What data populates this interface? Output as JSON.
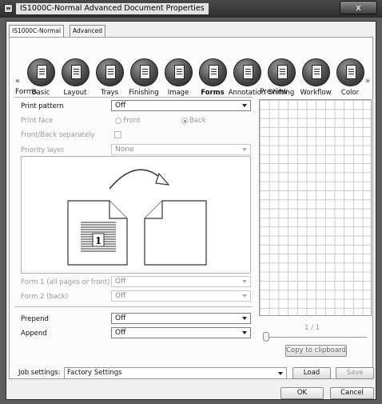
{
  "window": {
    "title": "IS1000C-Normal Advanced Document Properties",
    "close_glyph": "x"
  },
  "tabs": [
    {
      "label": "IS1000C-Normal",
      "selected": true
    },
    {
      "label": "Advanced",
      "selected": false
    }
  ],
  "categories": {
    "left_arrow": "«",
    "right_arrow": "»",
    "items": [
      {
        "label": "Basic",
        "icon": "basic-document-icon"
      },
      {
        "label": "Layout",
        "icon": "layout-icon"
      },
      {
        "label": "Trays",
        "icon": "trays-icon"
      },
      {
        "label": "Finishing",
        "icon": "finishing-icon"
      },
      {
        "label": "Image",
        "icon": "image-icon"
      },
      {
        "label": "Forms",
        "icon": "forms-icon",
        "active": true
      },
      {
        "label": "Annotation",
        "icon": "annotation-icon"
      },
      {
        "label": "Shifting",
        "icon": "shifting-icon"
      },
      {
        "label": "Workflow",
        "icon": "workflow-icon"
      },
      {
        "label": "Color",
        "icon": "color-icon"
      }
    ]
  },
  "forms": {
    "title": "Forms",
    "print_pattern": {
      "label": "Print pattern",
      "value": "Off"
    },
    "print_face": {
      "label": "Print face",
      "option_front": "Front",
      "option_back": "Back",
      "selected": "Back"
    },
    "front_back_separately": {
      "label": "Front/Back separately",
      "checked": false
    },
    "priority_layer": {
      "label": "Priority layer",
      "value": "None"
    },
    "illustration": {
      "page_number": "1"
    },
    "form1": {
      "label": "Form 1 (all pages or front)",
      "value": "Off"
    },
    "form2": {
      "label": "Form 2 (back)",
      "value": "Off"
    },
    "prepend": {
      "label": "Prepend",
      "value": "Off"
    },
    "append": {
      "label": "Append",
      "value": "Off"
    }
  },
  "preview": {
    "title": "Preview",
    "page_counter": "1 / 1",
    "copy_button": "Copy to clipboard"
  },
  "job_settings": {
    "label": "Job settings:",
    "value": "Factory Settings",
    "load": "Load",
    "save": "Save"
  },
  "footer": {
    "ok": "OK",
    "cancel": "Cancel"
  }
}
